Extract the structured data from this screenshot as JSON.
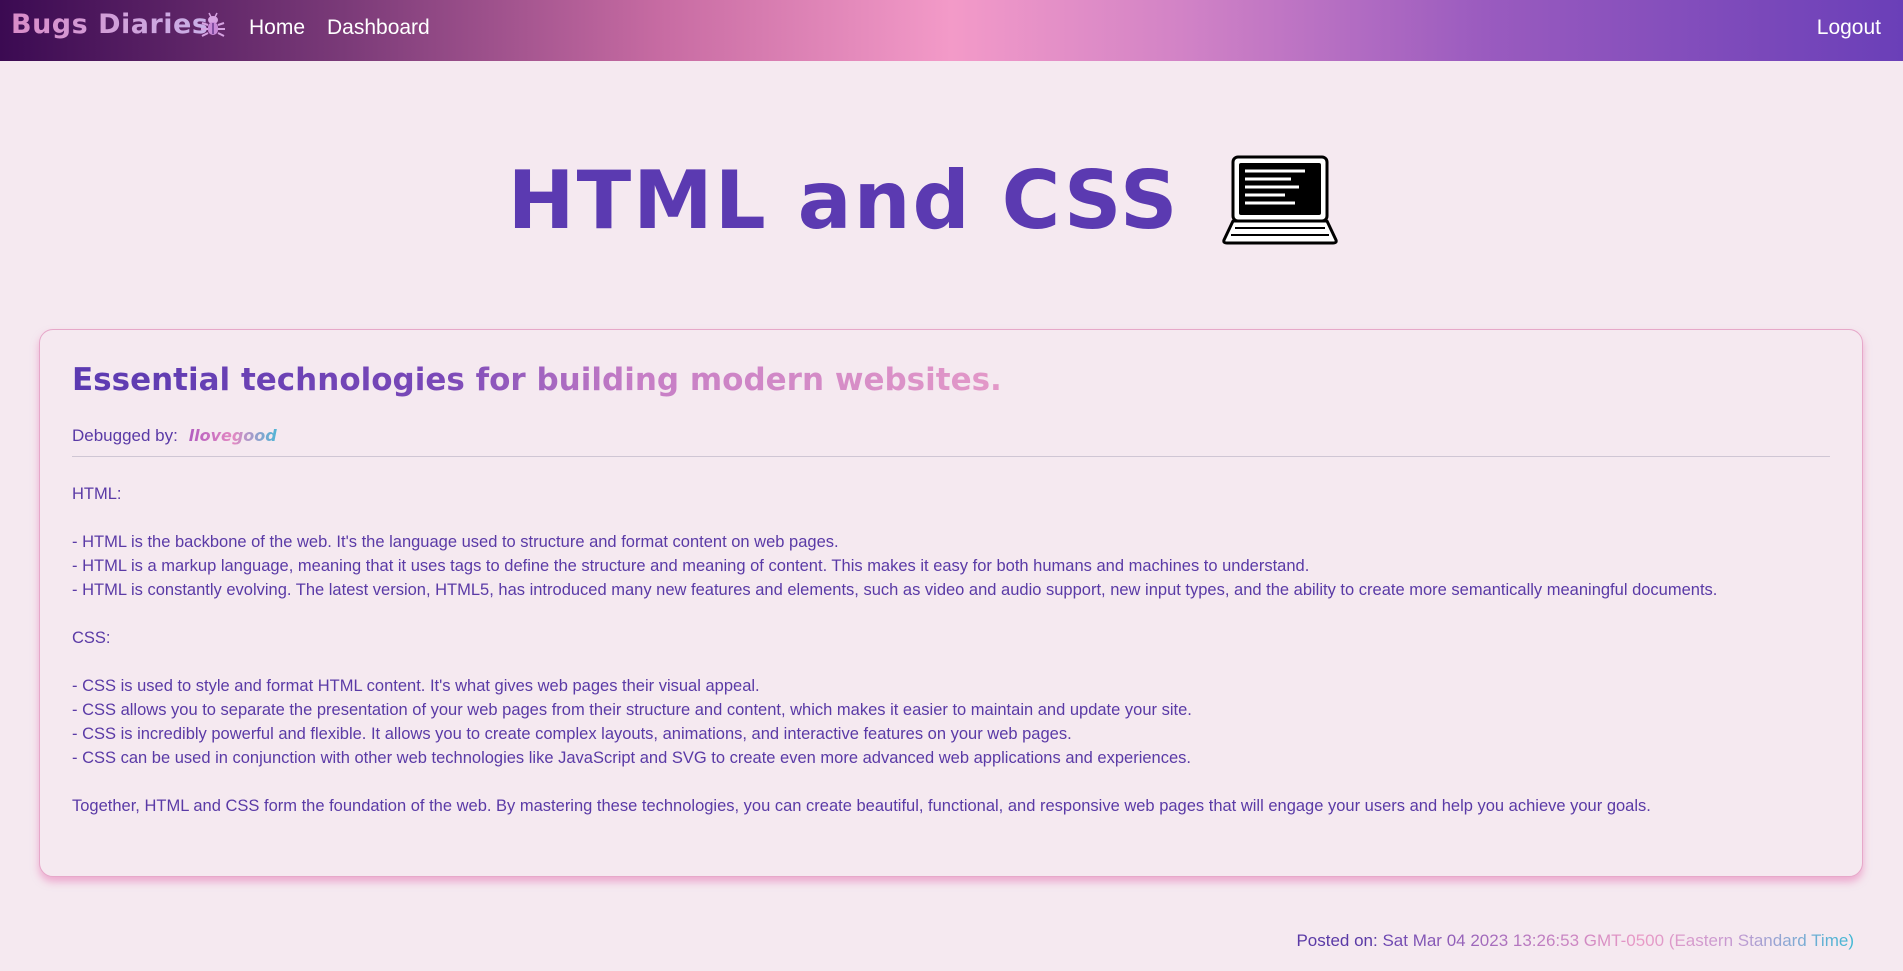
{
  "navbar": {
    "brand": "Bugs Diaries",
    "brand_icon": "bug-icon",
    "links": [
      {
        "label": "Home"
      },
      {
        "label": "Dashboard"
      }
    ],
    "logout_label": "Logout"
  },
  "page": {
    "title": "HTML and CSS",
    "title_icon": "laptop-icon"
  },
  "post": {
    "heading": "Essential technologies for building modern websites.",
    "debugged_label": "Debugged by:",
    "author": "llovegood",
    "body": [
      "HTML:",
      "",
      "- HTML is the backbone of the web. It's the language used to structure and format content on web pages.",
      "- HTML is a markup language, meaning that it uses tags to define the structure and meaning of content. This makes it easy for both humans and machines to understand.",
      "- HTML is constantly evolving. The latest version, HTML5, has introduced many new features and elements, such as video and audio support, new input types, and the ability to create more semantically meaningful documents.",
      "",
      "CSS:",
      "",
      "- CSS is used to style and format HTML content. It's what gives web pages their visual appeal.",
      "- CSS allows you to separate the presentation of your web pages from their structure and content, which makes it easier to maintain and update your site.",
      "- CSS is incredibly powerful and flexible. It allows you to create complex layouts, animations, and interactive features on your web pages.",
      "- CSS can be used in conjunction with other web technologies like JavaScript and SVG to create even more advanced web applications and experiences.",
      "",
      "Together, HTML and CSS form the foundation of the web. By mastering these technologies, you can create beautiful, functional, and responsive web pages that will engage your users and help you achieve your goals."
    ]
  },
  "footer": {
    "posted_label": "Posted on:",
    "posted_date": "Sat Mar 04 2023 13:26:53 GMT-0500 (Eastern Standard Time)"
  },
  "colors": {
    "primary": "#5b3ab1",
    "background": "#f5e9f0",
    "accent_pink": "#f39ac8",
    "card_border": "#e6a8c9"
  }
}
